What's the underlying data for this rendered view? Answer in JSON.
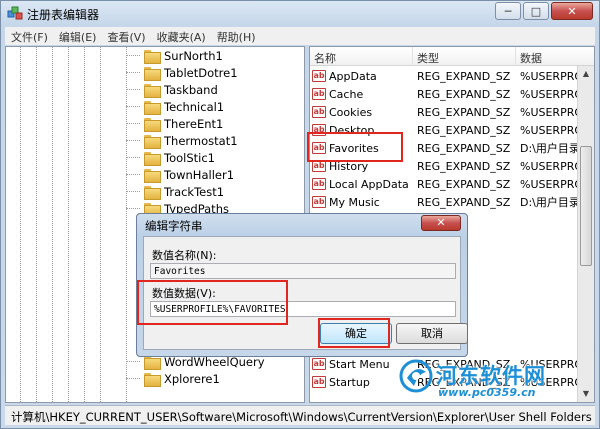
{
  "window": {
    "title": "注册表编辑器",
    "controls": {
      "minimize": "─",
      "maximize": "□",
      "close": "✕"
    }
  },
  "menubar": [
    "文件(F)",
    "编辑(E)",
    "查看(V)",
    "收藏夹(A)",
    "帮助(H)"
  ],
  "tree": {
    "items": [
      "SurNorth1",
      "TabletDotre1",
      "Taskband",
      "Technical1",
      "ThereEnt1",
      "Thermostat1",
      "ToolStic1",
      "TownHaller1",
      "TrackTest1",
      "TypedPaths",
      "WordWheelQuery",
      "Xplorere1"
    ]
  },
  "values_list": {
    "columns": [
      "名称",
      "类型",
      "数据"
    ],
    "rows": [
      {
        "name": "AppData",
        "type": "REG_EXPAND_SZ",
        "data": "%USERPROF"
      },
      {
        "name": "Cache",
        "type": "REG_EXPAND_SZ",
        "data": "%USERPROF"
      },
      {
        "name": "Cookies",
        "type": "REG_EXPAND_SZ",
        "data": "%USERPROF"
      },
      {
        "name": "Desktop",
        "type": "REG_EXPAND_SZ",
        "data": "%USERPROF"
      },
      {
        "name": "Favorites",
        "type": "REG_EXPAND_SZ",
        "data": "D:\\用户目录\\"
      },
      {
        "name": "History",
        "type": "REG_EXPAND_SZ",
        "data": "%USERPROF"
      },
      {
        "name": "Local AppData",
        "type": "REG_EXPAND_SZ",
        "data": "%USERPROF"
      },
      {
        "name": "My Music",
        "type": "REG_EXPAND_SZ",
        "data": "D:\\用户目录\\"
      },
      {
        "name": "Start Menu",
        "type": "REG_EXPAND_SZ",
        "data": "%USERPROF"
      },
      {
        "name": "Startup",
        "type": "REG_EXPAND_SZ",
        "data": "%USERPROF"
      }
    ]
  },
  "dialog": {
    "title": "编辑字符串",
    "close": "✕",
    "value_name_label": "数值名称(N):",
    "value_name": "Favorites",
    "value_data_label": "数值数据(V):",
    "value_data": "%USERPROFILE%\\FAVORITES",
    "ok_label": "确定",
    "cancel_label": "取消"
  },
  "statusbar": {
    "path": "计算机\\HKEY_CURRENT_USER\\Software\\Microsoft\\Windows\\CurrentVersion\\Explorer\\User Shell Folders"
  },
  "watermark": {
    "title": "河东软件网",
    "url": "www.pc0359.cn"
  },
  "colors": {
    "highlight_red": "#e0261f",
    "watermark_blue": "#1d8fd6"
  }
}
